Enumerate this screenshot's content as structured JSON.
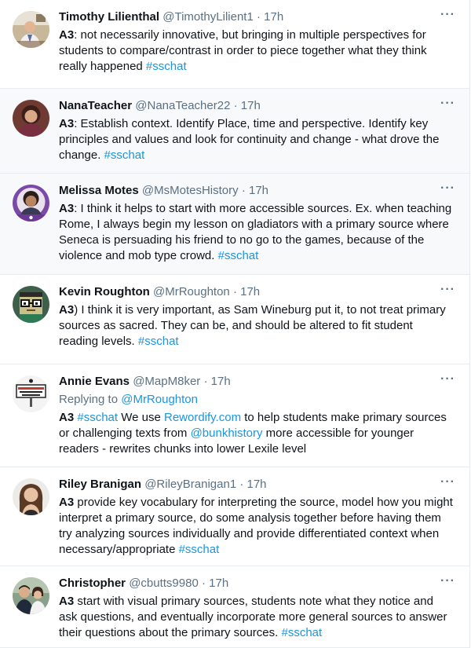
{
  "more_label": "···",
  "tweets": [
    {
      "name": "Timothy Lilienthal",
      "handle": "@TimothyLilient1",
      "separator": "·",
      "time": "17h",
      "prefix": "A3",
      "text": ": not necessarily innovative, but bringing in multiple perspectives for students to compare/contrast in order to piece together what they think really happened ",
      "hashtag": "#sschat",
      "avatar": "man-in-office-photo"
    },
    {
      "name": "NanaTeacher",
      "handle": "@NanaTeacher22",
      "separator": "·",
      "time": "17h",
      "prefix": "A3",
      "text": ": Establish context.  Identify Place, time and perspective.  Identify key principles and values and look for continuity and change - what drove the change. ",
      "hashtag": "#sschat",
      "avatar": "woman-portrait-photo"
    },
    {
      "name": "Melissa Motes",
      "handle": "@MsMotesHistory",
      "separator": "·",
      "time": "17h",
      "prefix": "A3",
      "text": ":  I think it helps to start with more accessible sources.  Ex. when teaching Rome, I always begin my lesson on gladiators with a primary source where Seneca is persuading his friend to no go to the games, because of the violence and mob type crowd. ",
      "hashtag": "#sschat",
      "avatar": "woman-purple-frame-photo"
    },
    {
      "name": "Kevin Roughton",
      "handle": "@MrRoughton",
      "separator": "·",
      "time": "17h",
      "prefix": "A3",
      "text": ") I think it is very important, as Sam Wineburg put it, to not treat primary sources as sacred. They can be, and should be altered to fit student reading levels. ",
      "hashtag": "#sschat",
      "avatar": "pixel-art-glasses-avatar"
    },
    {
      "name": "Annie Evans",
      "handle": "@MapM8ker",
      "separator": "·",
      "time": "17h",
      "replying_label": "Replying to ",
      "replying_to": "@MrRoughton",
      "prefix": "A3",
      "hashtag": "#sschat",
      "text_a": " We use ",
      "link": "Rewordify.com",
      "text_b": " to help students make primary sources or challenging texts from ",
      "mention": "@bunkhistory",
      "text_c": " more accessible for younger readers - rewrites chunks into lower Lexile level",
      "avatar": "sign-logo-avatar"
    },
    {
      "name": "Riley Branigan",
      "handle": "@RileyBranigan1",
      "separator": "·",
      "time": "17h",
      "prefix": "A3",
      "text": " provide key vocabulary for interpreting the source, model how you might interpret a primary source, do some analysis together before having them try analyzing sources individually and provide differentiated context when necessary/appropriate  ",
      "hashtag": "#sschat",
      "avatar": "woman-smiling-photo"
    },
    {
      "name": "Christopher",
      "handle": "@cbutts9980",
      "separator": "·",
      "time": "17h",
      "prefix": "A3",
      "text": " start with visual primary sources, students note what they notice and ask questions, and eventually incorporate more general sources to answer their questions about the primary sources. ",
      "hashtag": "#sschat",
      "avatar": "couple-photo"
    }
  ]
}
